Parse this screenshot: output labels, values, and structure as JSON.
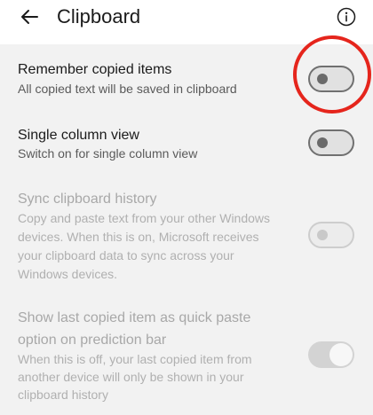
{
  "header": {
    "title": "Clipboard",
    "back_icon": "arrow-back-icon",
    "info_icon": "info-icon"
  },
  "settings": [
    {
      "title": "Remember copied items",
      "description": "All copied text will be saved in clipboard",
      "enabled": true,
      "toggle_on": false,
      "highlighted": true
    },
    {
      "title": "Single column view",
      "description": "Switch on for single column view",
      "enabled": true,
      "toggle_on": false
    },
    {
      "title": "Sync clipboard history",
      "description_lines": [
        "Copy and paste text from your other Windows",
        "devices. When this is on, Microsoft receives",
        "your clipboard data to sync across your",
        "Windows devices."
      ],
      "enabled": false,
      "toggle_on": false
    },
    {
      "title_lines": [
        "Show last copied item as quick paste",
        "option on prediction bar"
      ],
      "description_lines": [
        "When this is off, your last copied item from",
        "another device will only be shown in your",
        "clipboard history"
      ],
      "enabled": false,
      "toggle_on": true
    }
  ],
  "colors": {
    "highlight": "#e5251c",
    "background": "#f2f2f2",
    "appbar": "#ffffff"
  }
}
